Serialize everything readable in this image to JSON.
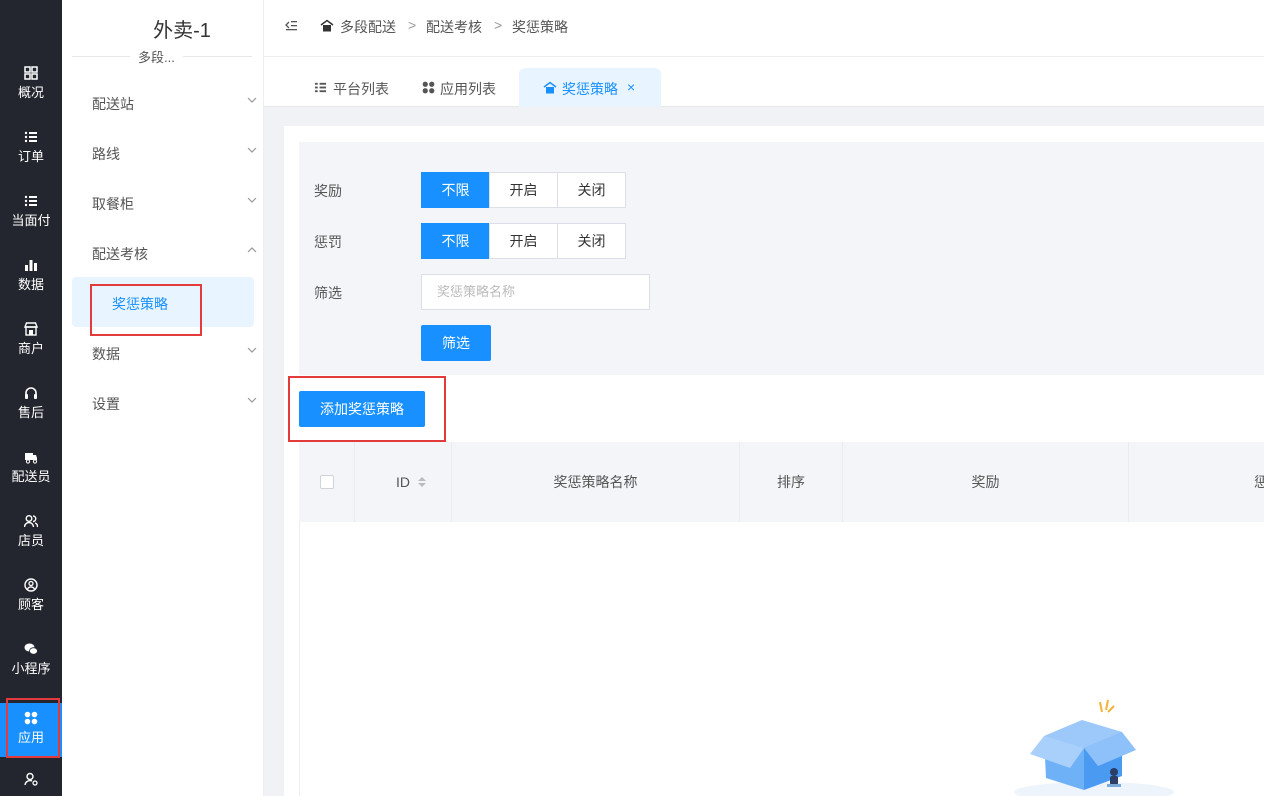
{
  "left_nav": {
    "items": [
      {
        "label": "概况",
        "icon": "grid-icon"
      },
      {
        "label": "订单",
        "icon": "list-icon"
      },
      {
        "label": "当面付",
        "icon": "list-icon"
      },
      {
        "label": "数据",
        "icon": "bar-chart-icon"
      },
      {
        "label": "商户",
        "icon": "store-icon"
      },
      {
        "label": "售后",
        "icon": "headset-icon"
      },
      {
        "label": "配送员",
        "icon": "delivery-truck-icon"
      },
      {
        "label": "店员",
        "icon": "users-icon"
      },
      {
        "label": "顾客",
        "icon": "user-circle-icon"
      },
      {
        "label": "小程序",
        "icon": "wechat-icon"
      },
      {
        "label": "应用",
        "icon": "apps-icon"
      }
    ],
    "active": "应用",
    "accent": "#1890ff"
  },
  "sidebar": {
    "store_name": "外卖-1",
    "store_sub": "多段...",
    "menu": [
      {
        "label": "配送站"
      },
      {
        "label": "路线"
      },
      {
        "label": "取餐柜"
      },
      {
        "label": "配送考核"
      },
      {
        "label": "数据"
      },
      {
        "label": "设置"
      }
    ],
    "active_child": "奖惩策略"
  },
  "breadcrumb": {
    "items": [
      "多段配送",
      "配送考核",
      "奖惩策略"
    ],
    "separator": ">"
  },
  "tabs": [
    {
      "label": "平台列表"
    },
    {
      "label": "应用列表"
    },
    {
      "label": "奖惩策略"
    }
  ],
  "filter": {
    "reward_label": "奖励",
    "penalty_label": "惩罚",
    "filter_label": "筛选",
    "options": [
      "不限",
      "开启",
      "关闭"
    ],
    "reward_selected": "不限",
    "penalty_selected": "不限",
    "search_placeholder": "奖惩策略名称",
    "filter_button": "筛选"
  },
  "add_button": "添加奖惩策略",
  "table": {
    "columns": [
      "ID",
      "奖惩策略名称",
      "排序",
      "奖励",
      "惩"
    ]
  }
}
